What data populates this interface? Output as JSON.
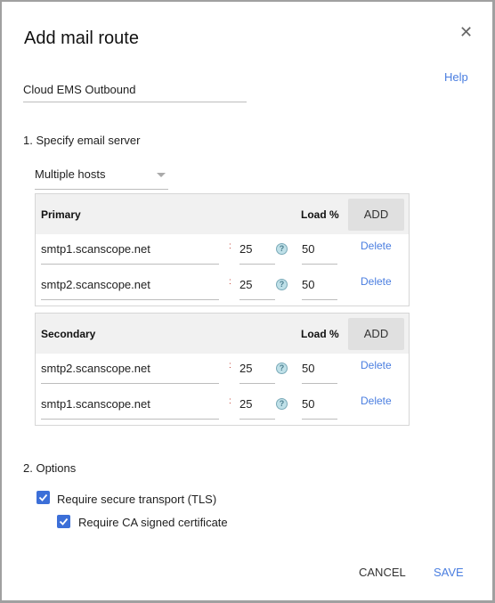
{
  "dialog": {
    "title": "Add mail route",
    "help": "Help",
    "close_icon": "close-icon"
  },
  "route_name": "Cloud EMS Outbound",
  "section1": "1. Specify email server",
  "host_mode": "Multiple hosts",
  "primary": {
    "header": "Primary",
    "load_label": "Load %",
    "add": "ADD",
    "rows": [
      {
        "host": "smtp1.scanscope.net",
        "port": "25",
        "load": "50",
        "delete": "Delete"
      },
      {
        "host": "smtp2.scanscope.net",
        "port": "25",
        "load": "50",
        "delete": "Delete"
      }
    ]
  },
  "secondary": {
    "header": "Secondary",
    "load_label": "Load %",
    "add": "ADD",
    "rows": [
      {
        "host": "smtp2.scanscope.net",
        "port": "25",
        "load": "50",
        "delete": "Delete"
      },
      {
        "host": "smtp1.scanscope.net",
        "port": "25",
        "load": "50",
        "delete": "Delete"
      }
    ]
  },
  "colon": ":",
  "help_glyph": "?",
  "section2": "2. Options",
  "options": [
    {
      "label": "Require secure transport (TLS)",
      "checked": true
    },
    {
      "label": "Require CA signed certificate",
      "checked": true
    }
  ],
  "footer": {
    "cancel": "CANCEL",
    "save": "SAVE"
  },
  "colors": {
    "accent": "#3c6fd8",
    "link": "#4a7ee0"
  }
}
